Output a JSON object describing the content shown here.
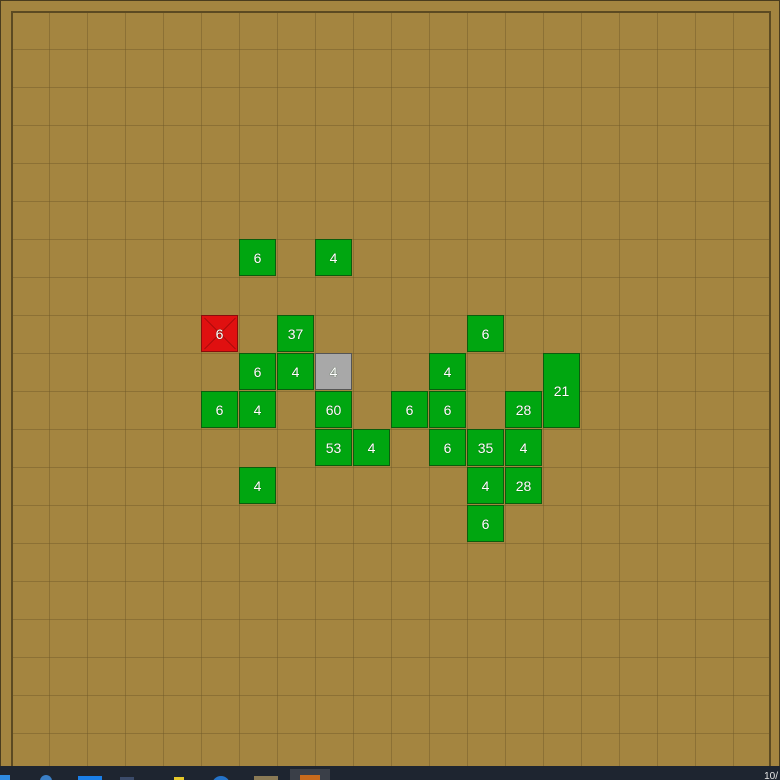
{
  "board": {
    "cell_size": 38,
    "tiles": [
      {
        "col": 6,
        "row": 6,
        "label": "6",
        "state": "revealed"
      },
      {
        "col": 8,
        "row": 6,
        "label": "4",
        "state": "revealed"
      },
      {
        "col": 5,
        "row": 8,
        "label": "6",
        "state": "flagged"
      },
      {
        "col": 7,
        "row": 8,
        "label": "37",
        "state": "revealed"
      },
      {
        "col": 12,
        "row": 8,
        "label": "6",
        "state": "revealed"
      },
      {
        "col": 6,
        "row": 9,
        "label": "6",
        "state": "revealed"
      },
      {
        "col": 7,
        "row": 9,
        "label": "4",
        "state": "revealed"
      },
      {
        "col": 8,
        "row": 9,
        "label": "4",
        "state": "selected"
      },
      {
        "col": 11,
        "row": 9,
        "label": "4",
        "state": "revealed"
      },
      {
        "col": 14,
        "row": 9,
        "label": "21",
        "state": "revealed",
        "rowspan": 2
      },
      {
        "col": 5,
        "row": 10,
        "label": "6",
        "state": "revealed"
      },
      {
        "col": 6,
        "row": 10,
        "label": "4",
        "state": "revealed"
      },
      {
        "col": 8,
        "row": 10,
        "label": "60",
        "state": "revealed"
      },
      {
        "col": 10,
        "row": 10,
        "label": "6",
        "state": "revealed"
      },
      {
        "col": 11,
        "row": 10,
        "label": "6",
        "state": "revealed"
      },
      {
        "col": 13,
        "row": 10,
        "label": "28",
        "state": "revealed"
      },
      {
        "col": 8,
        "row": 11,
        "label": "53",
        "state": "revealed"
      },
      {
        "col": 9,
        "row": 11,
        "label": "4",
        "state": "revealed"
      },
      {
        "col": 11,
        "row": 11,
        "label": "6",
        "state": "revealed"
      },
      {
        "col": 12,
        "row": 11,
        "label": "35",
        "state": "revealed"
      },
      {
        "col": 13,
        "row": 11,
        "label": "4",
        "state": "revealed"
      },
      {
        "col": 6,
        "row": 12,
        "label": "4",
        "state": "revealed"
      },
      {
        "col": 12,
        "row": 12,
        "label": "4",
        "state": "revealed"
      },
      {
        "col": 13,
        "row": 12,
        "label": "28",
        "state": "revealed"
      },
      {
        "col": 12,
        "row": 13,
        "label": "6",
        "state": "revealed"
      }
    ]
  },
  "colors": {
    "board": "#a48540",
    "tile_revealed": "#00a610",
    "tile_flagged": "#e01010",
    "tile_selected": "#a8a8a8"
  },
  "taskbar": {
    "clock": "10/",
    "icons": [
      "start-icon",
      "edge-icon",
      "explorer-icon",
      "vscode-icon",
      "warning-icon",
      "browser-icon",
      "app-icon",
      "game-icon"
    ]
  }
}
